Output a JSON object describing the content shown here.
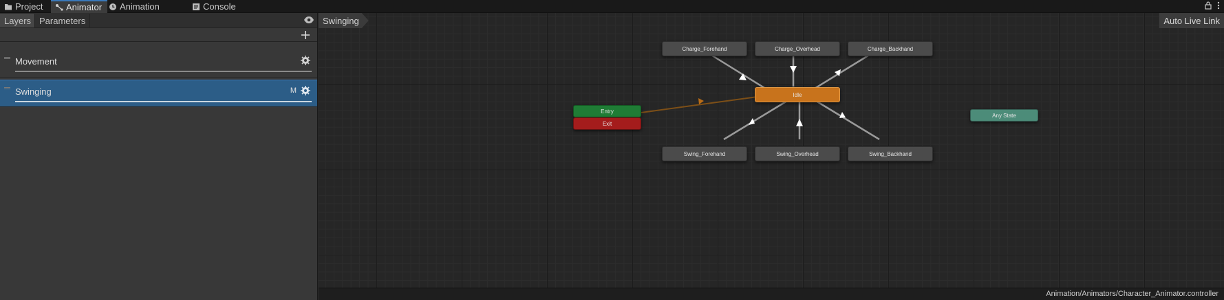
{
  "tabs": [
    {
      "label": "Project",
      "icon": "folder-icon"
    },
    {
      "label": "Animator",
      "icon": "animator-icon"
    },
    {
      "label": "Animation",
      "icon": "clock-icon"
    },
    {
      "label": "Console",
      "icon": "console-icon"
    }
  ],
  "active_tab": "Animator",
  "left_panel": {
    "subtabs": [
      "Layers",
      "Parameters"
    ],
    "active_subtab": "Layers",
    "layers": [
      {
        "name": "Movement",
        "selected": false,
        "badge": ""
      },
      {
        "name": "Swinging",
        "selected": true,
        "badge": "M"
      }
    ]
  },
  "graph": {
    "breadcrumb": "Swinging",
    "auto_live_link": "Auto Live Link",
    "states": {
      "charge_forehand": "Charge_Forehand",
      "charge_overhead": "Charge_Overhead",
      "charge_backhand": "Charge_Backhand",
      "idle": "Idle",
      "entry": "Entry",
      "exit": "Exit",
      "any_state": "Any State",
      "swing_forehand": "Swing_Forehand",
      "swing_overhead": "Swing_Overhead",
      "swing_backhand": "Swing_Backhand"
    }
  },
  "status": {
    "path": "Animation/Animators/Character_Animator.controller"
  },
  "colors": {
    "accent": "#3a79bb",
    "default_state": "#c8731c",
    "entry": "#1f7c35",
    "exit": "#a41c1c",
    "any_state": "#4c8c79",
    "selected_layer": "#2c5d87"
  }
}
